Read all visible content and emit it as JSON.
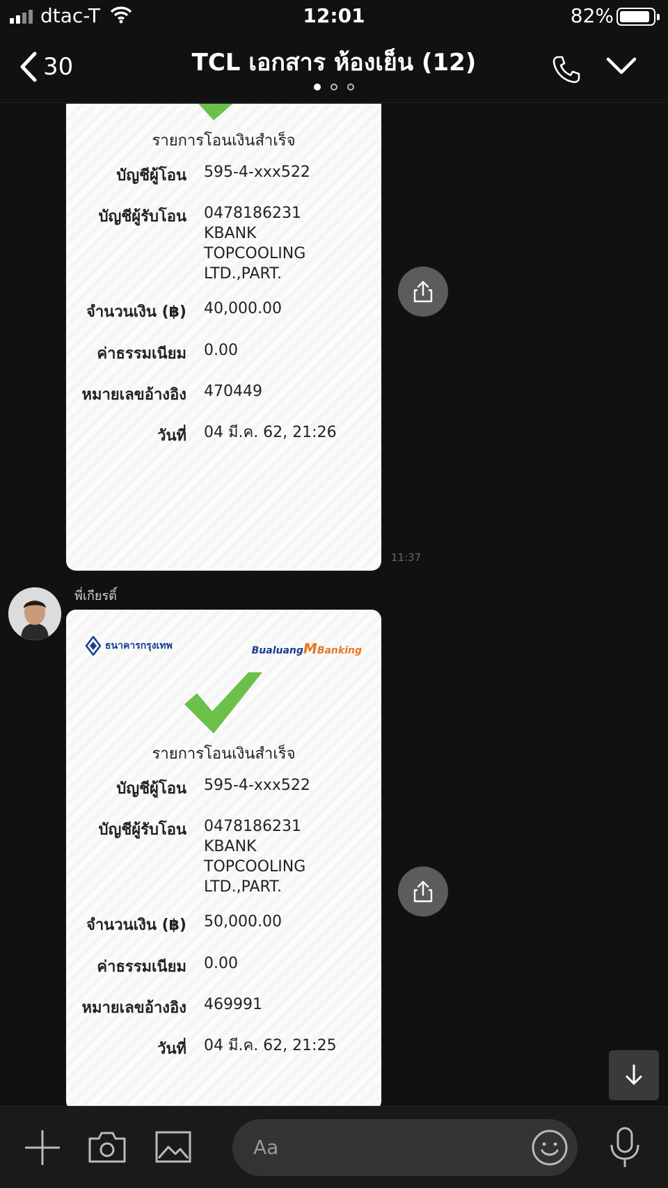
{
  "status_bar": {
    "carrier": "dtac-T",
    "time": "12:01",
    "battery": "82%"
  },
  "header": {
    "back_count": "30",
    "title": "TCL เอกสาร ห้องเย็น (12)"
  },
  "messages": [
    {
      "status": "รายการโอนเงินสำเร็จ",
      "from_label": "บัญชีผู้โอน",
      "from_value": "595-4-xxx522",
      "to_label": "บัญชีผู้รับโอน",
      "to_lines": [
        "0478186231",
        "KBANK",
        "TOPCOOLING",
        "LTD.,PART."
      ],
      "amount_label": "จำนวนเงิน (฿)",
      "amount_value": "40,000.00",
      "fee_label": "ค่าธรรมเนียม",
      "fee_value": "0.00",
      "ref_label": "หมายเลขอ้างอิง",
      "ref_value": "470449",
      "date_label": "วันที่",
      "date_value": "04 มี.ค. 62, 21:26",
      "time": "11:37"
    },
    {
      "sender": "พี่เกียรติ์",
      "bank_name": "ธนาคารกรุงเทพ",
      "app_logo": "Bualuang",
      "app_logo_m": "M",
      "app_logo_banking": "Banking",
      "status": "รายการโอนเงินสำเร็จ",
      "from_label": "บัญชีผู้โอน",
      "from_value": "595-4-xxx522",
      "to_label": "บัญชีผู้รับโอน",
      "to_lines": [
        "0478186231",
        "KBANK",
        "TOPCOOLING",
        "LTD.,PART."
      ],
      "amount_label": "จำนวนเงิน (฿)",
      "amount_value": "50,000.00",
      "fee_label": "ค่าธรรมเนียม",
      "fee_value": "0.00",
      "ref_label": "หมายเลขอ้างอิง",
      "ref_value": "469991",
      "date_label": "วันที่",
      "date_value": "04 มี.ค. 62, 21:25"
    }
  ],
  "input": {
    "placeholder": "Aa"
  },
  "colors": {
    "background": "#111111",
    "check": "#6cc04a",
    "bank_blue": "#1a3c8f",
    "bank_orange": "#e87722"
  },
  "icons": [
    "signal-icon",
    "wifi-icon",
    "battery-icon",
    "back-chevron-icon",
    "phone-icon",
    "chevron-down-icon",
    "checkmark-icon",
    "share-icon",
    "arrow-down-icon",
    "plus-icon",
    "camera-icon",
    "image-icon",
    "emoji-icon",
    "microphone-icon"
  ]
}
